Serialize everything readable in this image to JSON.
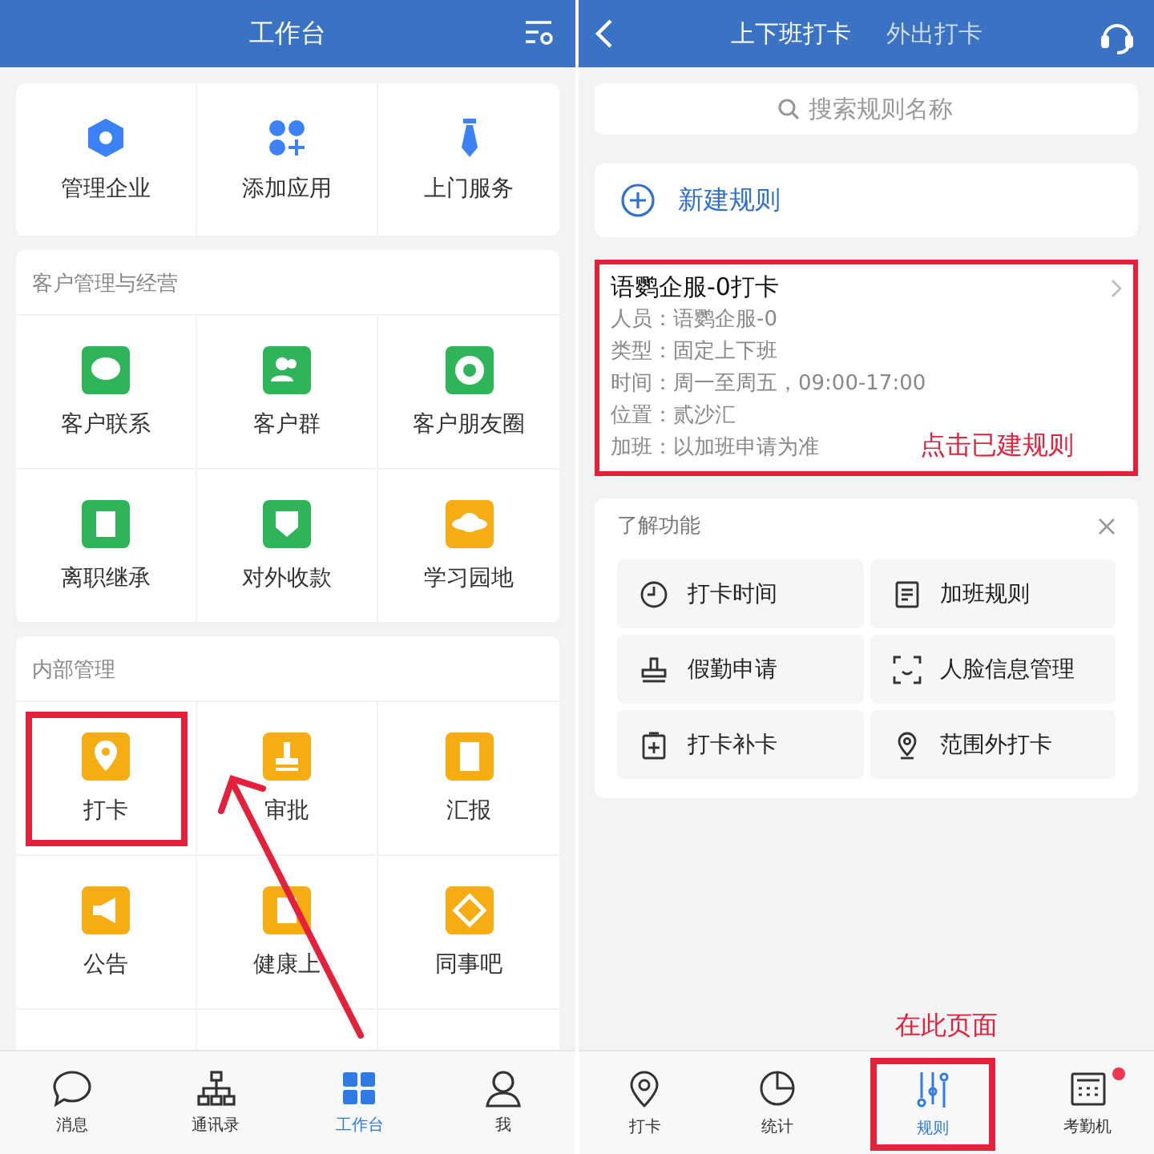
{
  "left": {
    "title": "工作台",
    "sections": [
      {
        "items": [
          {
            "label": "管理企业",
            "color": "#3b82f6",
            "marked": false
          },
          {
            "label": "添加应用",
            "color": "#3b82f6",
            "marked": false
          },
          {
            "label": "上门服务",
            "color": "#3b82f6",
            "marked": false
          }
        ]
      },
      {
        "heading": "客户管理与经营",
        "items": [
          {
            "label": "客户联系",
            "color": "#2fb45a",
            "marked": false
          },
          {
            "label": "客户群",
            "color": "#2fb45a",
            "marked": false
          },
          {
            "label": "客户朋友圈",
            "color": "#2fb45a",
            "marked": false
          },
          {
            "label": "离职继承",
            "color": "#2fb45a",
            "marked": false
          },
          {
            "label": "对外收款",
            "color": "#2fb45a",
            "marked": false
          },
          {
            "label": "学习园地",
            "color": "#f6ad14",
            "marked": false
          }
        ]
      },
      {
        "heading": "内部管理",
        "items": [
          {
            "label": "打卡",
            "color": "#f6ad14",
            "marked": true
          },
          {
            "label": "审批",
            "color": "#f6ad14",
            "marked": false
          },
          {
            "label": "汇报",
            "color": "#f6ad14",
            "marked": false
          },
          {
            "label": "公告",
            "color": "#f6ad14",
            "marked": false
          },
          {
            "label": "健康上",
            "color": "#f6ad14",
            "marked": false
          },
          {
            "label": "同事吧",
            "color": "#f6ad14",
            "marked": false
          }
        ]
      }
    ],
    "tabbar": [
      {
        "label": "消息",
        "selected": false
      },
      {
        "label": "通讯录",
        "selected": false
      },
      {
        "label": "工作台",
        "selected": true
      },
      {
        "label": "我",
        "selected": false
      }
    ]
  },
  "right": {
    "tabs": [
      {
        "label": "上下班打卡",
        "selected": true
      },
      {
        "label": "外出打卡",
        "selected": false
      }
    ],
    "search": {
      "placeholder": "搜索规则名称"
    },
    "new_rule": "新建规则",
    "rule": {
      "title": "语鹦企服-0打卡",
      "lines": [
        "人员：语鹦企服-0",
        "类型：固定上下班",
        "时间：周一至周五，09:00-17:00",
        "位置：贰沙汇",
        "加班：以加班申请为准"
      ],
      "note": "点击已建规则",
      "marked": true
    },
    "features": {
      "title": "了解功能",
      "items": [
        "打卡时间",
        "加班规则",
        "假勤申请",
        "人脸信息管理",
        "打卡补卡",
        "范围外打卡"
      ]
    },
    "callout": "在此页面",
    "tabbar": [
      {
        "label": "打卡",
        "selected": false,
        "marked": false,
        "badge": false
      },
      {
        "label": "统计",
        "selected": false,
        "marked": false,
        "badge": false
      },
      {
        "label": "规则",
        "selected": true,
        "marked": true,
        "badge": false
      },
      {
        "label": "考勤机",
        "selected": false,
        "marked": false,
        "badge": true
      }
    ]
  }
}
